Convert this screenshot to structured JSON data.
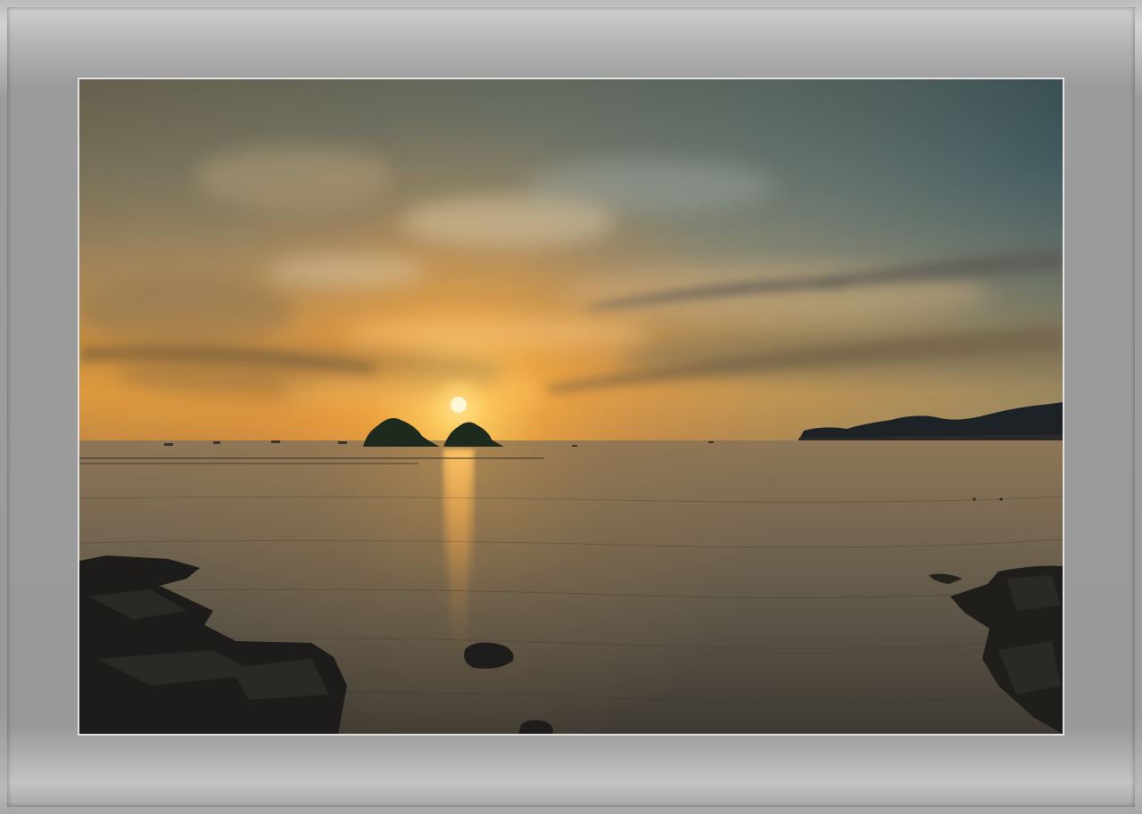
{
  "image": {
    "description_tag": "framed-photograph",
    "scene_elements": [
      "sky",
      "sun",
      "sea",
      "islands",
      "headland",
      "rocks"
    ],
    "colors": {
      "sky_top": "#3d5560",
      "sky_glow": "#f5a540",
      "sun": "#fff4c8",
      "sea": "#6a5f4c",
      "rock": "#1e1e1c",
      "frame": "#9a9a9a"
    }
  }
}
